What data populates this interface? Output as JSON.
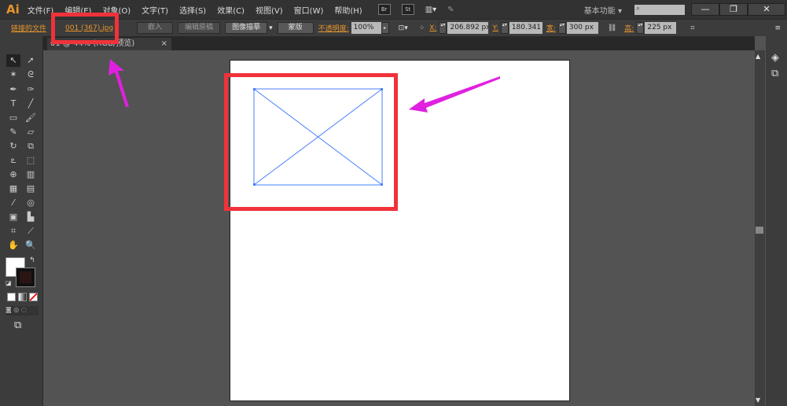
{
  "app": {
    "logo": "Ai",
    "workspace": "基本功能",
    "search_placeholder": ""
  },
  "menu": [
    "文件(F)",
    "编辑(E)",
    "对象(O)",
    "文字(T)",
    "选择(S)",
    "效果(C)",
    "视图(V)",
    "窗口(W)",
    "帮助(H)"
  ],
  "menu_icons": {
    "br": "Br",
    "st": "St"
  },
  "window_controls": {
    "minimize": "—",
    "restore": "❐",
    "close": "✕"
  },
  "control_bar": {
    "linked_file_label": "链接的文件",
    "file_name": "001 (367).jpg",
    "embed": "嵌入",
    "edit_original": "编辑原稿",
    "image_trace": "图像描摹",
    "mask": "蒙版",
    "opacity_label": "不透明度:",
    "opacity": "100%",
    "x_label": "X:",
    "x": "206.892 px",
    "y_label": "Y:",
    "y": "180.341 px",
    "w_label": "宽:",
    "w": "300 px",
    "h_label": "高:",
    "h": "225 px"
  },
  "document_tab": {
    "title": "01 @ 44% (RGB/预览)",
    "close": "×"
  },
  "colors": {
    "accent": "#e8952c",
    "annotation_red": "#f0323a",
    "annotation_arrow": "#e020e0",
    "selection": "#4a7fff"
  }
}
